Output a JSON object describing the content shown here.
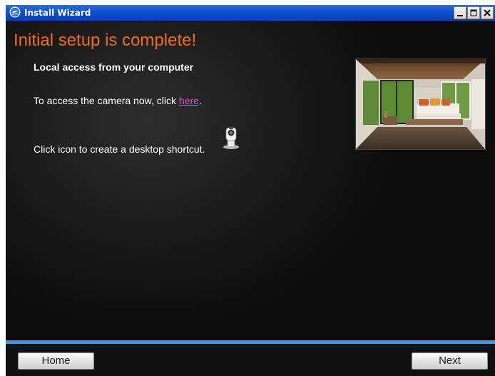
{
  "window": {
    "title": "Install Wizard",
    "controls": [
      "minimize",
      "maximize",
      "close"
    ]
  },
  "content": {
    "heading": "Initial setup is complete!",
    "subheading": "Local access from your computer",
    "access_text_before": "To access the camera now, click ",
    "access_link": "here",
    "access_text_after": ".",
    "shortcut_text": "Click icon to create a desktop shortcut."
  },
  "footer": {
    "home_label": "Home",
    "next_label": "Next"
  },
  "colors": {
    "heading": "#f26a1b",
    "link": "#d94dd9",
    "separator": "#3b9be0",
    "titlebar": "#0a4fd0"
  },
  "icons": {
    "title": "app-globe-icon",
    "shortcut": "camera-shortcut-icon"
  }
}
